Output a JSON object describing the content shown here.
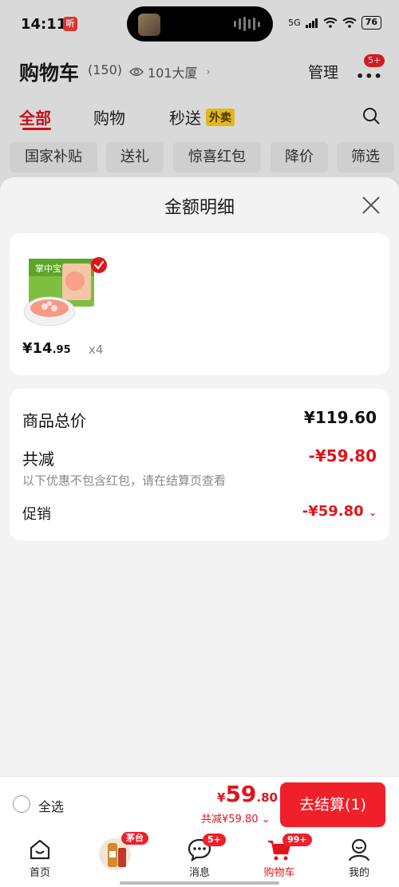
{
  "status_bar": {
    "time": "14:11",
    "recording_badge": "听",
    "network": "5G",
    "battery": "76"
  },
  "header": {
    "title": "购物车",
    "count": "(150)",
    "address": "101大厦",
    "manage_label": "管理",
    "more_badge": "5+"
  },
  "tabs": [
    {
      "label": "全部",
      "active": true
    },
    {
      "label": "购物",
      "active": false
    },
    {
      "label": "秒送",
      "active": false,
      "tag": "外卖"
    }
  ],
  "filter_chips": [
    "国家补贴",
    "送礼",
    "惊喜红包",
    "降价",
    "筛选"
  ],
  "sheet": {
    "title": "金额明细",
    "product": {
      "brand_text": "掌中宝",
      "price_currency": "¥",
      "price_int": "14",
      "price_dec": ".95",
      "quantity": "x4"
    },
    "summary": {
      "total_label": "商品总价",
      "total_value": "¥119.60",
      "discount_label": "共减",
      "discount_value": "-¥59.80",
      "note": "以下优惠不包含红包，请在结算页查看",
      "promo_label": "促销",
      "promo_value": "-¥59.80"
    }
  },
  "checkout": {
    "select_all_label": "全选",
    "total_currency": "¥",
    "total_int": "59",
    "total_dec": ".80",
    "saved_text": "共减¥59.80",
    "pay_label": "去结算(1)"
  },
  "bottom_nav": [
    {
      "label": "首页",
      "icon": "home-icon"
    },
    {
      "label": "",
      "icon": "moutai-promo-icon",
      "badge": "茅台"
    },
    {
      "label": "消息",
      "icon": "message-icon",
      "badge": "5+"
    },
    {
      "label": "购物车",
      "icon": "cart-icon",
      "badge": "99+",
      "active": true
    },
    {
      "label": "我的",
      "icon": "profile-icon"
    }
  ],
  "colors": {
    "accent": "#e0151b",
    "button": "#f0202a",
    "tag_yellow": "#ffd21e"
  }
}
